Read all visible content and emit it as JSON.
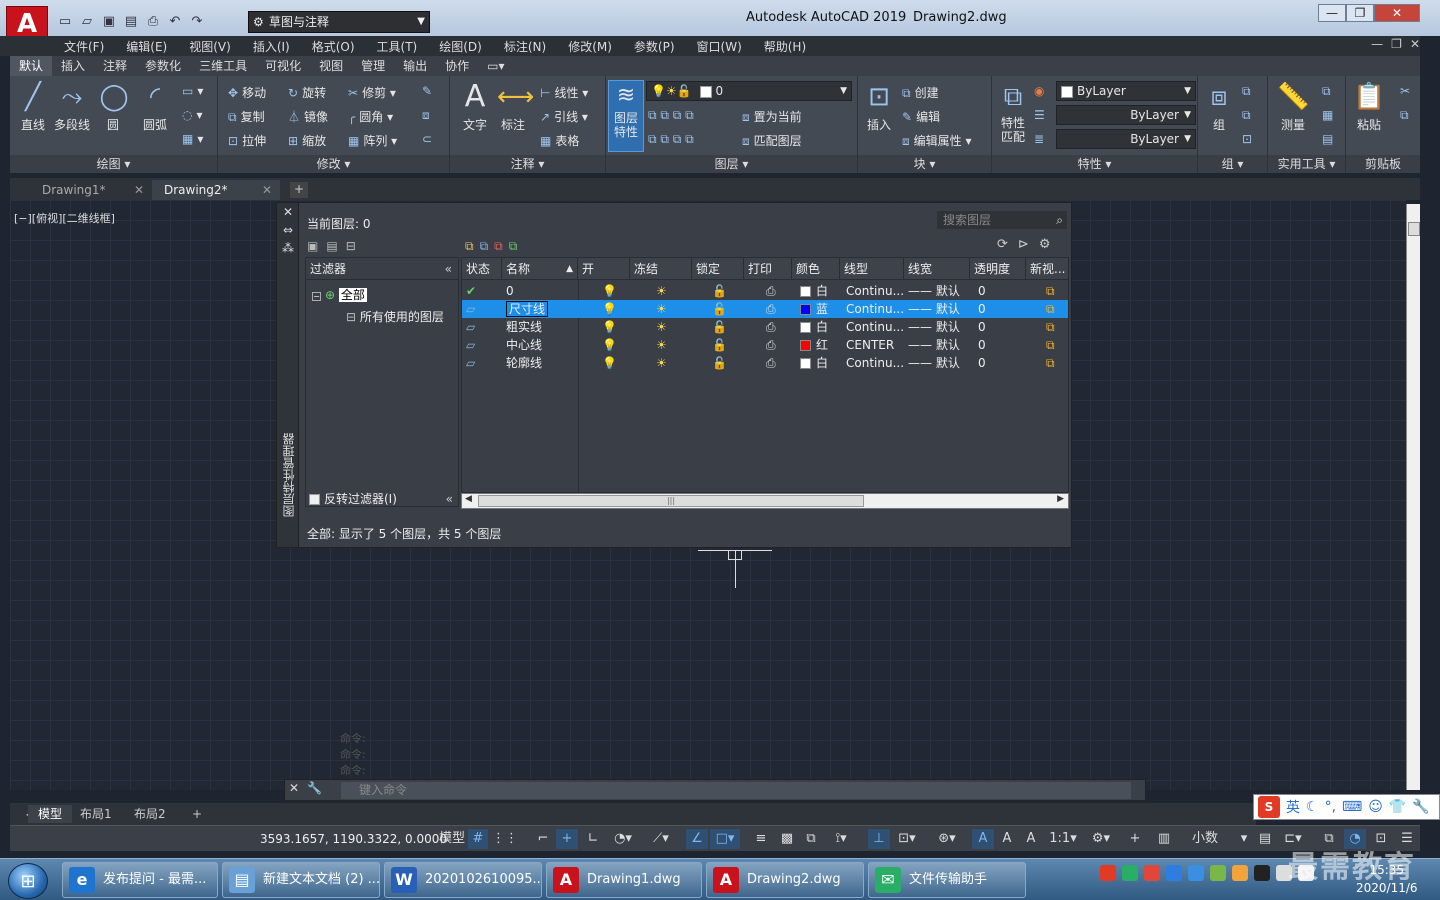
{
  "title_bar": {
    "app_title": "Autodesk AutoCAD 2019",
    "doc_title": "Drawing2.dwg",
    "workspace": "草图与注释",
    "logo": "A"
  },
  "menu": [
    "文件(F)",
    "编辑(E)",
    "视图(V)",
    "插入(I)",
    "格式(O)",
    "工具(T)",
    "绘图(D)",
    "标注(N)",
    "修改(M)",
    "参数(P)",
    "窗口(W)",
    "帮助(H)"
  ],
  "ribbon_tabs": [
    "默认",
    "插入",
    "注释",
    "参数化",
    "三维工具",
    "可视化",
    "视图",
    "管理",
    "输出",
    "协作"
  ],
  "ribbon": {
    "draw": {
      "title": "绘图",
      "line": "直线",
      "polyline": "多段线",
      "circle": "圆",
      "arc": "圆弧"
    },
    "modify": {
      "title": "修改",
      "move": "移动",
      "rotate": "旋转",
      "trim": "修剪",
      "copy": "复制",
      "mirror": "镜像",
      "fillet": "圆角",
      "stretch": "拉伸",
      "scale": "缩放",
      "array": "阵列"
    },
    "annotation": {
      "title": "注释",
      "text": "文字",
      "dimension": "标注",
      "linear": "线性",
      "leader": "引线",
      "table": "表格"
    },
    "layers": {
      "title": "图层",
      "layer_props_line1": "图层",
      "layer_props_line2": "特性",
      "current_layer": "0",
      "set_current": "置为当前",
      "match_layer": "匹配图层"
    },
    "block": {
      "title": "块",
      "insert": "插入",
      "create": "创建",
      "edit": "编辑",
      "edit_attr": "编辑属性"
    },
    "properties": {
      "title": "特性",
      "match_line1": "特性",
      "match_line2": "匹配",
      "color": "ByLayer",
      "linetype": "ByLayer",
      "lineweight": "ByLayer"
    },
    "groups": {
      "title": "组",
      "group": "组"
    },
    "utilities": {
      "title": "实用工具",
      "measure": "测量"
    },
    "clipboard": {
      "title": "剪贴板",
      "paste": "粘贴"
    }
  },
  "file_tabs": [
    {
      "label": "Drawing1*"
    },
    {
      "label": "Drawing2*"
    }
  ],
  "viewport_label": "[−][俯视][二维线框]",
  "command_history": [
    "命令:",
    "命令:",
    "命令:"
  ],
  "command_placeholder": "键入命令",
  "layout_tabs": [
    "模型",
    "布局1",
    "布局2"
  ],
  "status": {
    "coords": "3593.1657, 1190.3322, 0.0000",
    "model": "模型",
    "scale": "1:1",
    "units": "小数"
  },
  "layer_manager": {
    "palette_title": "图层特性管理器",
    "current_layer": "当前图层: 0",
    "search_placeholder": "搜索图层",
    "filters_header": "过滤器",
    "filter_all": "全部",
    "filter_used": "所有使用的图层",
    "invert_filter": "反转过滤器(I)",
    "columns": [
      "状态",
      "名称",
      "开",
      "冻结",
      "锁定",
      "打印",
      "颜色",
      "线型",
      "线宽",
      "透明度",
      "新视..."
    ],
    "layers": [
      {
        "name": "0",
        "color_name": "白",
        "color_hex": "#ffffff",
        "linetype": "Continu...",
        "lineweight": "默认",
        "transparency": "0",
        "current": true,
        "selected": false
      },
      {
        "name": "尺寸线",
        "color_name": "蓝",
        "color_hex": "#0000ff",
        "linetype": "Continu...",
        "lineweight": "默认",
        "transparency": "0",
        "current": false,
        "selected": true
      },
      {
        "name": "粗实线",
        "color_name": "白",
        "color_hex": "#ffffff",
        "linetype": "Continu...",
        "lineweight": "默认",
        "transparency": "0",
        "current": false,
        "selected": false
      },
      {
        "name": "中心线",
        "color_name": "红",
        "color_hex": "#ff0000",
        "linetype": "CENTER",
        "lineweight": "默认",
        "transparency": "0",
        "current": false,
        "selected": false
      },
      {
        "name": "轮廓线",
        "color_name": "白",
        "color_hex": "#ffffff",
        "linetype": "Continu...",
        "lineweight": "默认",
        "transparency": "0",
        "current": false,
        "selected": false
      }
    ],
    "status_text": "全部: 显示了 5 个图层，共 5 个图层"
  },
  "taskbar": {
    "items": [
      {
        "label": "发布提问 - 最需...",
        "icon": "ie-icon",
        "color": "#1f74d0"
      },
      {
        "label": "新建文本文档 (2) ...",
        "icon": "notepad-icon",
        "color": "#6aa0d8"
      },
      {
        "label": "2020102610095...",
        "icon": "wps-icon",
        "color": "#2a5fb8"
      },
      {
        "label": "Drawing1.dwg",
        "icon": "autocad-icon",
        "color": "#c8131c"
      },
      {
        "label": "Drawing2.dwg",
        "icon": "autocad-icon",
        "color": "#c8131c"
      },
      {
        "label": "文件传输助手",
        "icon": "wechat-icon",
        "color": "#2aae67"
      }
    ],
    "time": "15:35",
    "date": "2020/11/6"
  },
  "ime_lang": "英",
  "watermark": "最需教育"
}
